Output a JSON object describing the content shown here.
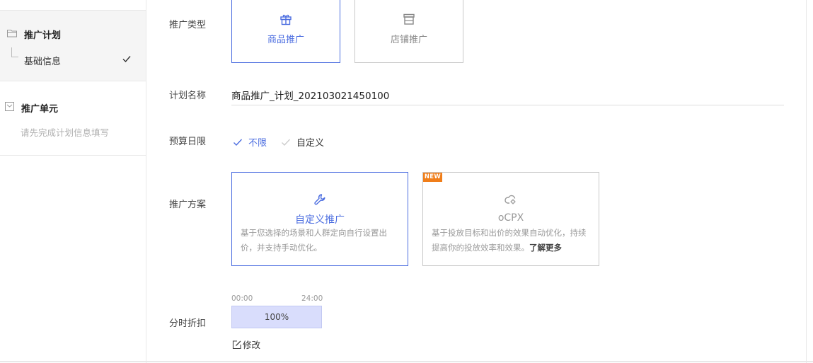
{
  "sidebar": {
    "plan": {
      "title": "推广计划",
      "sub_item": "基础信息"
    },
    "unit": {
      "title": "推广单元",
      "hint": "请先完成计划信息填写"
    }
  },
  "form": {
    "promo_type": {
      "label": "推广类型",
      "options": [
        {
          "label": "商品推广",
          "icon": "gift-icon",
          "selected": true
        },
        {
          "label": "店铺推广",
          "icon": "store-icon",
          "selected": false
        }
      ]
    },
    "plan_name": {
      "label": "计划名称",
      "value": "商品推广_计划_202103021450100"
    },
    "budget": {
      "label": "预算日限",
      "options": [
        {
          "label": "不限",
          "selected": true
        },
        {
          "label": "自定义",
          "selected": false
        }
      ]
    },
    "scheme": {
      "label": "推广方案",
      "options": [
        {
          "title": "自定义推广",
          "icon": "wrench-icon",
          "desc": "基于您选择的场景和人群定向自行设置出价，并支持手动优化。",
          "selected": true
        },
        {
          "title": "oCPX",
          "icon": "link-gear-icon",
          "badge": "NEW",
          "desc": "基于投放目标和出价的效果自动优化，持续提高你的投放效率和效果。",
          "more_link": "了解更多",
          "selected": false
        }
      ]
    },
    "time_discount": {
      "label": "分时折扣",
      "start": "00:00",
      "end": "24:00",
      "value": "100%",
      "edit_label": "修改"
    }
  },
  "colors": {
    "accent": "#4b6de0",
    "badge": "#f07e1a",
    "bar_fill": "#d9ddfc"
  }
}
